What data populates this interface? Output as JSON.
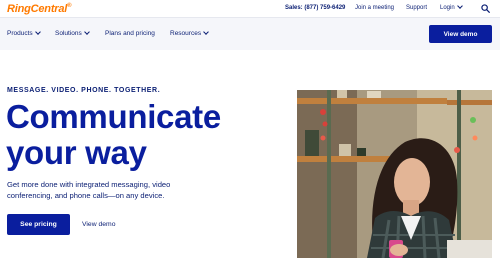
{
  "header": {
    "logo": "RingCentral",
    "logo_mark": "®",
    "sales": "Sales: (877) 759-6429",
    "join_meeting": "Join a meeting",
    "support": "Support",
    "login": "Login"
  },
  "nav": {
    "items": [
      "Products",
      "Solutions",
      "Plans and pricing",
      "Resources"
    ],
    "demo_button": "View demo"
  },
  "hero": {
    "eyebrow": "MESSAGE. VIDEO. PHONE. TOGETHER.",
    "headline_line1": "Communicate",
    "headline_line2": "your way",
    "subtext": "Get more done with integrated messaging, video conferencing, and phone calls—on any device.",
    "primary_cta": "See pricing",
    "secondary_cta": "View demo"
  },
  "colors": {
    "brand_orange": "#ff7a00",
    "brand_blue": "#0a1e9e",
    "text_navy": "#0a1e73",
    "nav_bg": "#f5f6fa"
  },
  "icons": [
    "search-icon",
    "chevron-down-icon"
  ]
}
